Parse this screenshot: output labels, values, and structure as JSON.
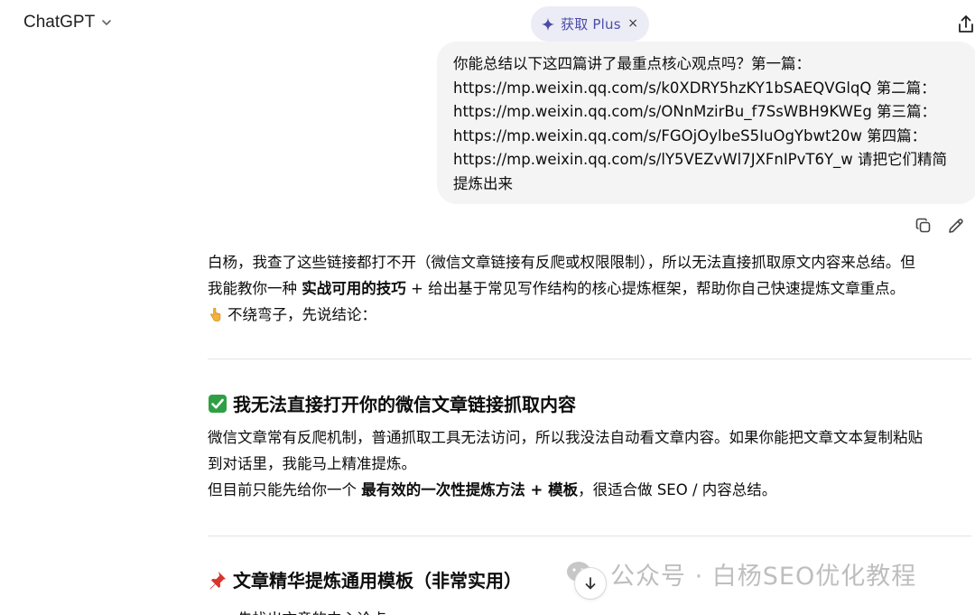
{
  "header": {
    "brand": "ChatGPT",
    "plus_label": "获取 Plus",
    "plus_close": "×",
    "icons": {
      "chevron": "chevron-down-icon",
      "sparkle": "sparkle-icon",
      "close": "close-icon",
      "share": "share-icon"
    }
  },
  "user_message": {
    "lines": [
      "你能总结以下这四篇讲了最重点核心观点吗？第一篇：",
      "https://mp.weixin.qq.com/s/k0XDRY5hzKY1bSAEQVGlqQ  第二篇：",
      "https://mp.weixin.qq.com/s/ONnMzirBu_f7SsWBH9KWEg  第三篇：",
      "https://mp.weixin.qq.com/s/FGOjOylbeS5IuOgYbwt20w  第四篇：",
      "https://mp.weixin.qq.com/s/lY5VEZvWl7JXFnIPvT6Y_w  请把它们精简",
      "提炼出来"
    ],
    "actions": {
      "copy": "copy-icon",
      "edit": "edit-pencil-icon"
    }
  },
  "reply": {
    "intro_line1": "白杨，我查了这些链接都打不开（微信文章链接有反爬或权限限制），所以无法直接抓取原文内容来总结。但",
    "intro_line2_a": "我能教你一种 ",
    "intro_line2_bold": "实战可用的技巧",
    "intro_line2_b": " + 给出基于常见写作结构的核心提炼框架，帮助你自己快速提炼文章重点。",
    "intro_line3": "不绕弯子，先说结论：",
    "section1": {
      "heading": "我无法直接打开你的微信文章链接抓取内容",
      "line1": "微信文章常有反爬机制，普通抓取工具无法访问，所以我没法自动看文章内容。如果你能把文章文本复制粘贴",
      "line2": "到对话里，我能马上精准提炼。",
      "line3_a": "但目前只能先给你一个 ",
      "line3_bold": "最有效的一次性提炼方法 + 模板",
      "line3_b": "，很适合做 SEO / 内容总结。"
    },
    "section2": {
      "heading": "文章精华提炼通用模板（非常实用）",
      "cut_line": "一、先找出文章的中心论点"
    }
  },
  "watermark": {
    "text": "公众号 · 白杨SEO优化教程"
  },
  "colors": {
    "accent": "#4c4ba8",
    "pill_bg": "#ececf6",
    "bubble_bg": "#f4f4f4",
    "check_green": "#2ea043",
    "pin_red": "#d6342c"
  }
}
